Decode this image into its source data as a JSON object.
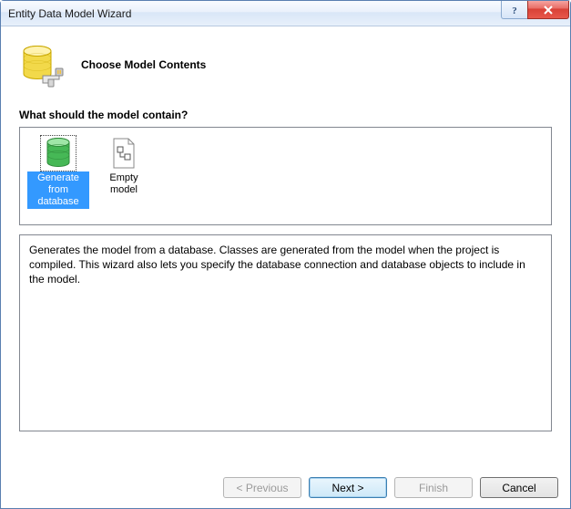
{
  "window": {
    "title": "Entity Data Model Wizard"
  },
  "header": {
    "title": "Choose Model Contents"
  },
  "section": {
    "prompt": "What should the model contain?"
  },
  "options": {
    "generate": {
      "label": "Generate from database"
    },
    "empty": {
      "label": "Empty model"
    }
  },
  "description": {
    "text": "Generates the model from a database. Classes are generated from the model when the project is compiled. This wizard also lets you specify the database connection and database objects to include in the model."
  },
  "buttons": {
    "previous": "< Previous",
    "next": "Next >",
    "finish": "Finish",
    "cancel": "Cancel"
  }
}
